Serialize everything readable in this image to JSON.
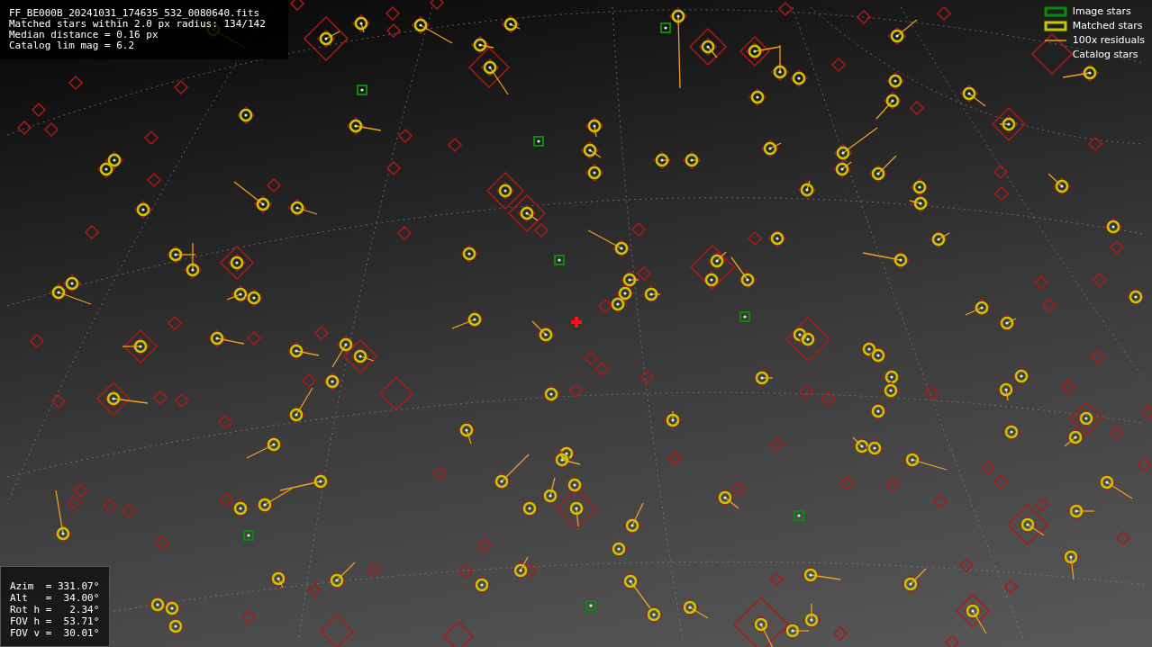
{
  "info_panel": {
    "lines": [
      "FF_BE000B_20241031_174635_532_0080640.fits",
      "Matched stars within 2.0 px radius: 134/142",
      "Median distance = 0.16 px",
      "Catalog lim mag = 6.2"
    ]
  },
  "legend": {
    "items": [
      {
        "kind": "image",
        "label": "Image stars"
      },
      {
        "kind": "matched",
        "label": "Matched stars"
      },
      {
        "kind": "residual",
        "label": "100x residuals"
      },
      {
        "kind": "catalog",
        "label": "Catalog stars"
      }
    ]
  },
  "pointing_panel": {
    "lines": [
      "Azim  = 331.07°",
      "Alt   =  34.00°",
      "Rot h =   2.34°",
      "FOV h =  53.71°",
      "FOV v =  30.01°"
    ]
  }
}
